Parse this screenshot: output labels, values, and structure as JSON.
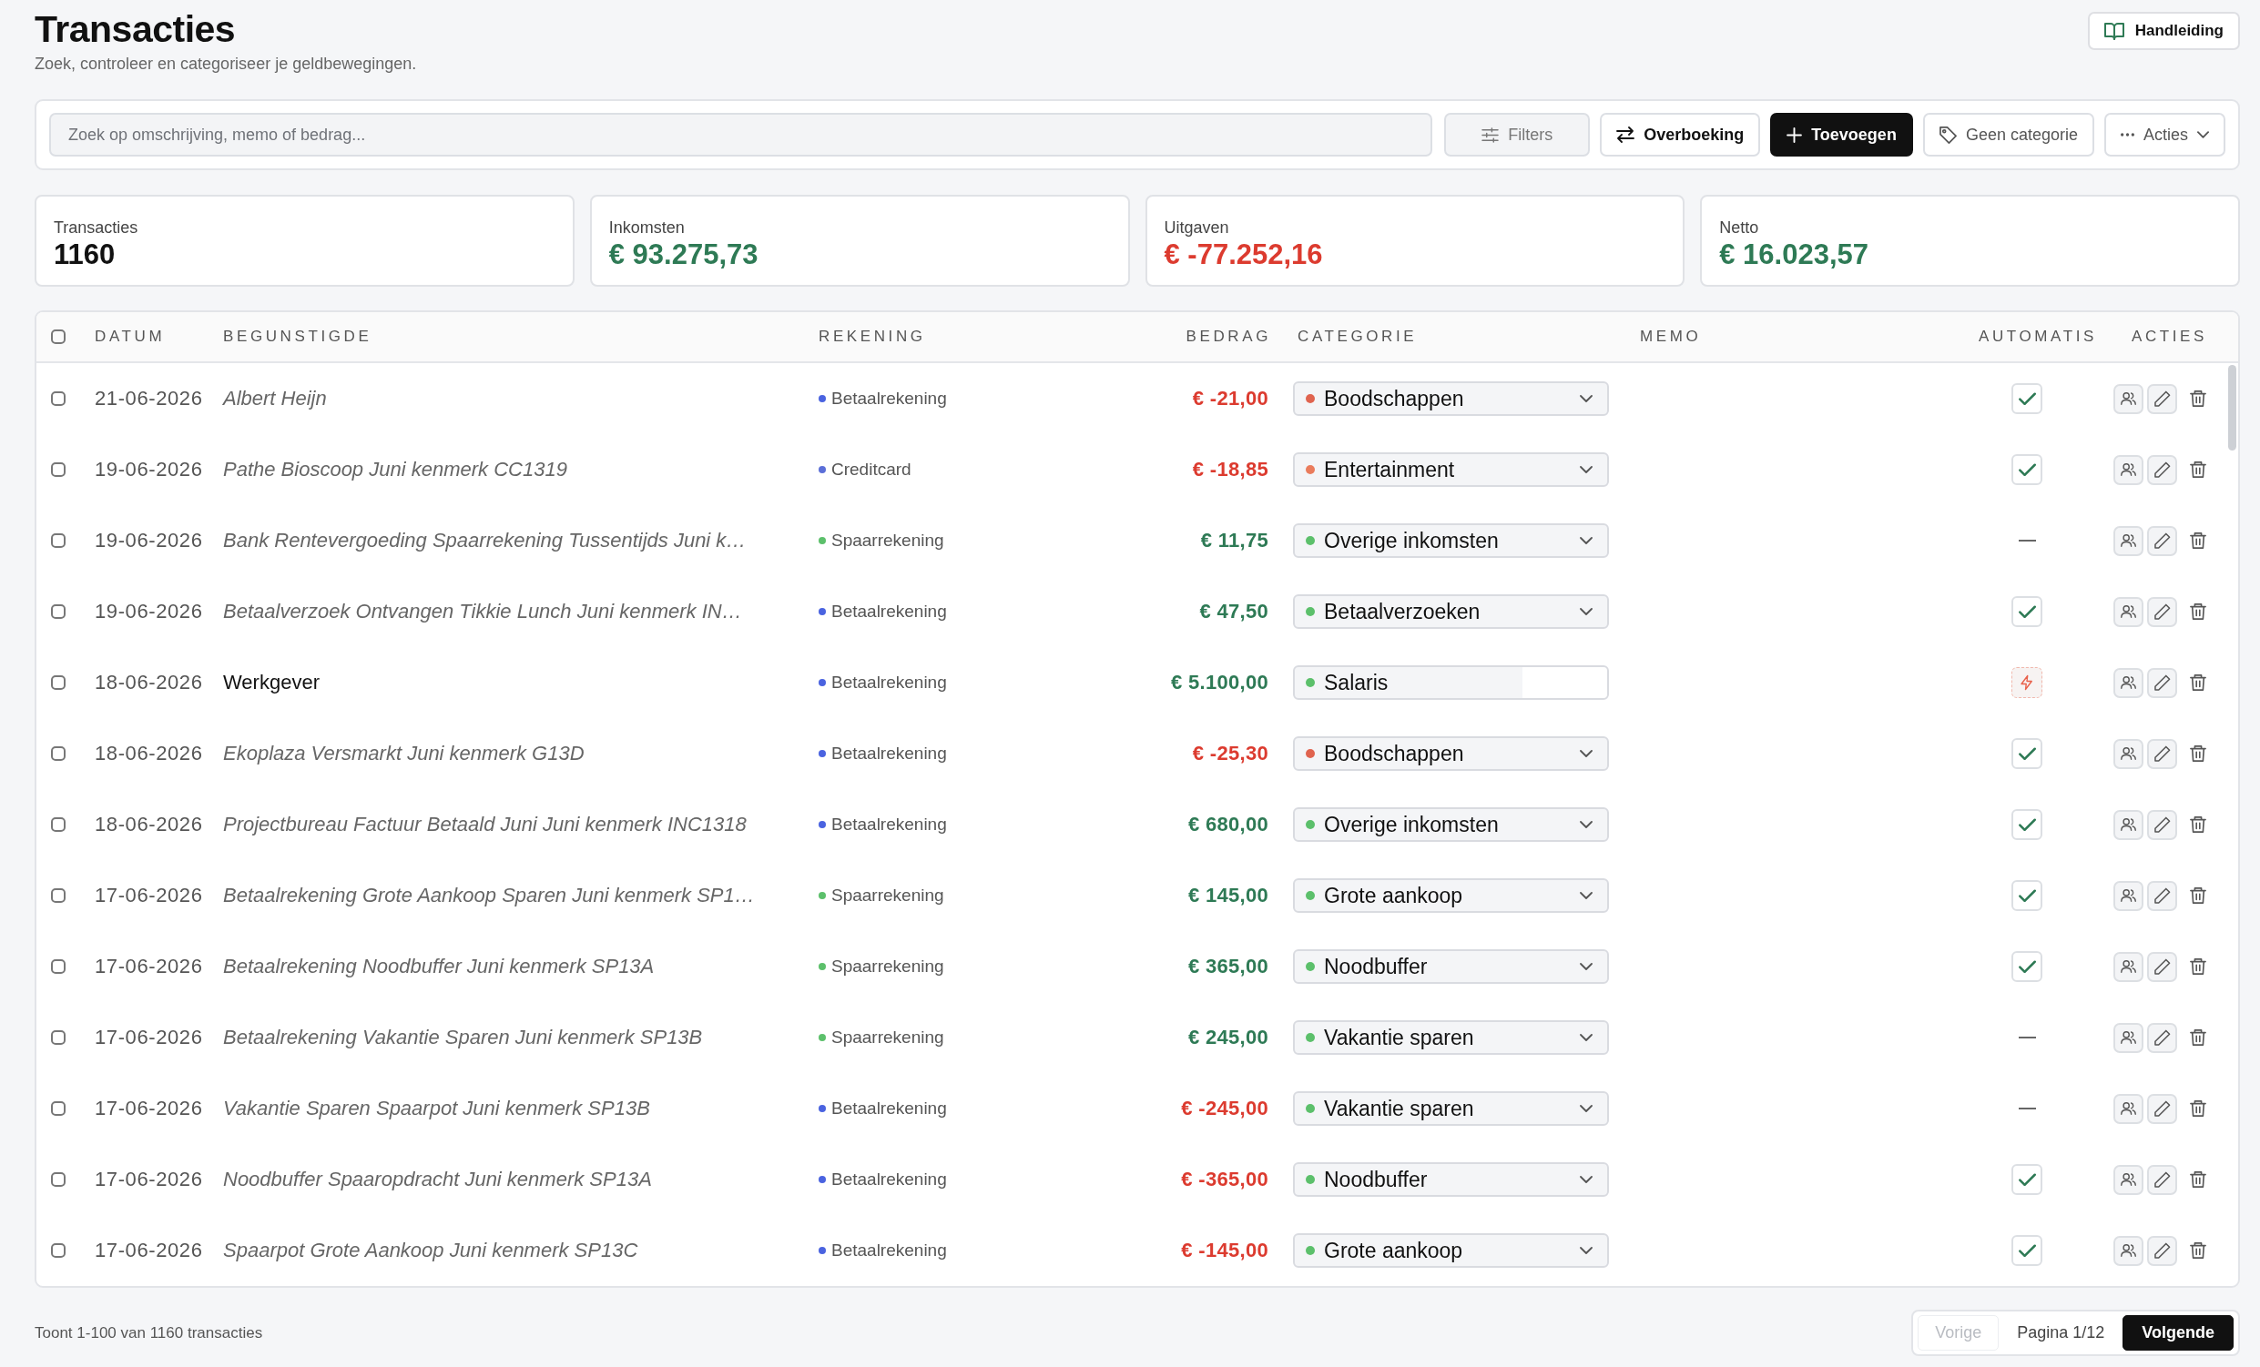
{
  "header": {
    "title": "Transacties",
    "subtitle": "Zoek, controleer en categoriseer je geldbewegingen.",
    "guide_button": "Handleiding"
  },
  "toolbar": {
    "search": {
      "placeholder": "Zoek op omschrijving, memo of bedrag..."
    },
    "buttons": [
      {
        "label": "Filters",
        "kind": "filter"
      },
      {
        "label": "Overboeking",
        "kind": "transfer"
      },
      {
        "label": "Toevoegen",
        "kind": "add"
      },
      {
        "label": "Geen categorie",
        "kind": "tag"
      },
      {
        "label": "Acties",
        "kind": "menu"
      }
    ]
  },
  "stats": [
    {
      "label": "Transacties",
      "value": "1160",
      "kind": "neutral"
    },
    {
      "label": "Inkomsten",
      "value": "€ 93.275,73",
      "kind": "positive"
    },
    {
      "label": "Uitgaven",
      "value": "€ -77.252,16",
      "kind": "negative"
    },
    {
      "label": "Netto",
      "value": "€ 16.023,57",
      "kind": "positive"
    }
  ],
  "table": {
    "select_all": {
      "checked": false
    },
    "columns": [
      "DATUM",
      "BEGUNSTIGDE",
      "REKENING",
      "BEDRAG",
      "CATEGORIE",
      "MEMO",
      "AUTOMATIS",
      "ACTIES"
    ],
    "rows": [
      {
        "selected": false,
        "date": "21-06-2026",
        "payee": {
          "text": "Albert Heijn",
          "kind": "description"
        },
        "account": {
          "name": "Betaalrekening",
          "color": "#4a63e0"
        },
        "amount": {
          "text": "€ -21,00",
          "negative": true
        },
        "category": {
          "name": "Boodschappen",
          "color": "#e0644f",
          "locked": false
        },
        "automation": {
          "kind": "check"
        }
      },
      {
        "selected": false,
        "date": "19-06-2026",
        "payee": {
          "text": "Pathe Bioscoop Juni kenmerk CC1319",
          "kind": "description"
        },
        "account": {
          "name": "Creditcard",
          "color": "#5b6fd8"
        },
        "amount": {
          "text": "€ -18,85",
          "negative": true
        },
        "category": {
          "name": "Entertainment",
          "color": "#ea7c5c",
          "locked": false
        },
        "automation": {
          "kind": "check"
        }
      },
      {
        "selected": false,
        "date": "19-06-2026",
        "payee": {
          "text": "Bank Rentevergoeding Spaarrekening Tussentijds Juni k…",
          "kind": "description"
        },
        "account": {
          "name": "Spaarrekening",
          "color": "#5cc06b"
        },
        "amount": {
          "text": "€ 11,75",
          "negative": false
        },
        "category": {
          "name": "Overige inkomsten",
          "color": "#5cc06b",
          "locked": false
        },
        "automation": {
          "kind": "none"
        }
      },
      {
        "selected": false,
        "date": "19-06-2026",
        "payee": {
          "text": "Betaalverzoek Ontvangen Tikkie Lunch Juni kenmerk IN…",
          "kind": "description"
        },
        "account": {
          "name": "Betaalrekening",
          "color": "#4a63e0"
        },
        "amount": {
          "text": "€ 47,50",
          "negative": false
        },
        "category": {
          "name": "Betaalverzoeken",
          "color": "#5cc06b",
          "locked": false
        },
        "automation": {
          "kind": "check"
        }
      },
      {
        "selected": false,
        "date": "18-06-2026",
        "payee": {
          "text": "Werkgever",
          "kind": "payee"
        },
        "account": {
          "name": "Betaalrekening",
          "color": "#4a63e0"
        },
        "amount": {
          "text": "€ 5.100,00",
          "negative": false
        },
        "category": {
          "name": "Salaris",
          "color": "#5cc06b",
          "locked": true
        },
        "automation": {
          "kind": "rule"
        }
      },
      {
        "selected": false,
        "date": "18-06-2026",
        "payee": {
          "text": "Ekoplaza Versmarkt Juni kenmerk G13D",
          "kind": "description"
        },
        "account": {
          "name": "Betaalrekening",
          "color": "#4a63e0"
        },
        "amount": {
          "text": "€ -25,30",
          "negative": true
        },
        "category": {
          "name": "Boodschappen",
          "color": "#e0644f",
          "locked": false
        },
        "automation": {
          "kind": "check"
        }
      },
      {
        "selected": false,
        "date": "18-06-2026",
        "payee": {
          "text": "Projectbureau Factuur Betaald Juni Juni kenmerk INC1318",
          "kind": "description"
        },
        "account": {
          "name": "Betaalrekening",
          "color": "#4a63e0"
        },
        "amount": {
          "text": "€ 680,00",
          "negative": false
        },
        "category": {
          "name": "Overige inkomsten",
          "color": "#5cc06b",
          "locked": false
        },
        "automation": {
          "kind": "check"
        }
      },
      {
        "selected": false,
        "date": "17-06-2026",
        "payee": {
          "text": "Betaalrekening Grote Aankoop Sparen Juni kenmerk SP1…",
          "kind": "description"
        },
        "account": {
          "name": "Spaarrekening",
          "color": "#5cc06b"
        },
        "amount": {
          "text": "€ 145,00",
          "negative": false
        },
        "category": {
          "name": "Grote aankoop",
          "color": "#5cc06b",
          "locked": false
        },
        "automation": {
          "kind": "check"
        }
      },
      {
        "selected": false,
        "date": "17-06-2026",
        "payee": {
          "text": "Betaalrekening Noodbuffer Juni kenmerk SP13A",
          "kind": "description"
        },
        "account": {
          "name": "Spaarrekening",
          "color": "#5cc06b"
        },
        "amount": {
          "text": "€ 365,00",
          "negative": false
        },
        "category": {
          "name": "Noodbuffer",
          "color": "#5cc06b",
          "locked": false
        },
        "automation": {
          "kind": "check"
        }
      },
      {
        "selected": false,
        "date": "17-06-2026",
        "payee": {
          "text": "Betaalrekening Vakantie Sparen Juni kenmerk SP13B",
          "kind": "description"
        },
        "account": {
          "name": "Spaarrekening",
          "color": "#5cc06b"
        },
        "amount": {
          "text": "€ 245,00",
          "negative": false
        },
        "category": {
          "name": "Vakantie sparen",
          "color": "#5cc06b",
          "locked": false
        },
        "automation": {
          "kind": "none"
        }
      },
      {
        "selected": false,
        "date": "17-06-2026",
        "payee": {
          "text": "Vakantie Sparen Spaarpot Juni kenmerk SP13B",
          "kind": "description"
        },
        "account": {
          "name": "Betaalrekening",
          "color": "#4a63e0"
        },
        "amount": {
          "text": "€ -245,00",
          "negative": true
        },
        "category": {
          "name": "Vakantie sparen",
          "color": "#5cc06b",
          "locked": false
        },
        "automation": {
          "kind": "none"
        }
      },
      {
        "selected": false,
        "date": "17-06-2026",
        "payee": {
          "text": "Noodbuffer Spaaropdracht Juni kenmerk SP13A",
          "kind": "description"
        },
        "account": {
          "name": "Betaalrekening",
          "color": "#4a63e0"
        },
        "amount": {
          "text": "€ -365,00",
          "negative": true
        },
        "category": {
          "name": "Noodbuffer",
          "color": "#5cc06b",
          "locked": false
        },
        "automation": {
          "kind": "check"
        }
      },
      {
        "selected": false,
        "date": "17-06-2026",
        "payee": {
          "text": "Spaarpot Grote Aankoop Juni kenmerk SP13C",
          "kind": "description"
        },
        "account": {
          "name": "Betaalrekening",
          "color": "#4a63e0"
        },
        "amount": {
          "text": "€ -145,00",
          "negative": true
        },
        "category": {
          "name": "Grote aankoop",
          "color": "#5cc06b",
          "locked": false
        },
        "automation": {
          "kind": "check"
        }
      }
    ]
  },
  "footer": {
    "summary": "Toont 1-100 van 1160 transacties",
    "pagination": {
      "previous": {
        "label": "Vorige",
        "disabled": true
      },
      "page": "Pagina 1/12",
      "next": {
        "label": "Volgende",
        "disabled": false
      }
    }
  }
}
